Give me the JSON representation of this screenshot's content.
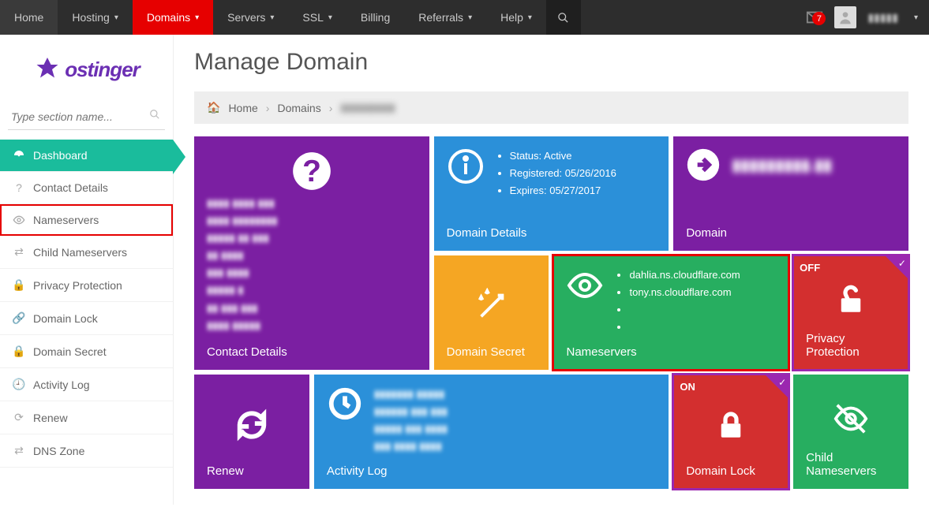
{
  "topnav": {
    "items": [
      {
        "label": "Home",
        "dropdown": false
      },
      {
        "label": "Hosting",
        "dropdown": true
      },
      {
        "label": "Domains",
        "dropdown": true
      },
      {
        "label": "Servers",
        "dropdown": true
      },
      {
        "label": "SSL",
        "dropdown": true
      },
      {
        "label": "Billing",
        "dropdown": false
      },
      {
        "label": "Referrals",
        "dropdown": true
      },
      {
        "label": "Help",
        "dropdown": true
      }
    ],
    "active_index": 2,
    "notification_count": "7",
    "user_name": "▮▮▮▮▮"
  },
  "logo_text": "ostinger",
  "side_search_placeholder": "Type section name...",
  "sidebar": {
    "items": [
      {
        "label": "Dashboard"
      },
      {
        "label": "Contact Details"
      },
      {
        "label": "Nameservers"
      },
      {
        "label": "Child Nameservers"
      },
      {
        "label": "Privacy Protection"
      },
      {
        "label": "Domain Lock"
      },
      {
        "label": "Domain Secret"
      },
      {
        "label": "Activity Log"
      },
      {
        "label": "Renew"
      },
      {
        "label": "DNS Zone"
      }
    ]
  },
  "page_title": "Manage Domain",
  "breadcrumb": {
    "home": "Home",
    "domains": "Domains",
    "current": "▮▮▮▮▮▮▮▮▮"
  },
  "tiles": {
    "contact": {
      "label": "Contact Details",
      "lines": [
        "▮▮▮▮ ▮▮▮▮ ▮▮▮",
        "▮▮▮▮ ▮▮▮▮▮▮▮▮",
        "▮▮▮▮▮ ▮▮ ▮▮▮",
        "▮▮ ▮▮▮▮",
        "▮▮▮ ▮▮▮▮",
        "▮▮▮▮▮ ▮",
        "▮▮ ▮▮▮ ▮▮▮",
        "▮▮▮▮ ▮▮▮▮▮"
      ]
    },
    "details": {
      "label": "Domain Details",
      "status": "Status: Active",
      "registered": "Registered: 05/26/2016",
      "expires": "Expires: 05/27/2017"
    },
    "domain": {
      "label": "Domain",
      "value": "▮▮▮▮▮▮▮▮▮.▮▮"
    },
    "secret": {
      "label": "Domain Secret"
    },
    "ns": {
      "label": "Nameservers",
      "servers": [
        "dahlia.ns.cloudflare.com",
        "tony.ns.cloudflare.com",
        "",
        ""
      ]
    },
    "privacy": {
      "label": "Privacy Protection",
      "tag": "OFF"
    },
    "renew": {
      "label": "Renew"
    },
    "log": {
      "label": "Activity Log",
      "lines": [
        "▮▮▮▮▮▮▮ ▮▮▮▮▮",
        "▮▮▮▮▮▮ ▮▮▮ ▮▮▮",
        "▮▮▮▮▮ ▮▮▮ ▮▮▮▮",
        "▮▮▮ ▮▮▮▮ ▮▮▮▮"
      ]
    },
    "lock": {
      "label": "Domain Lock",
      "tag": "ON"
    },
    "child": {
      "label": "Child Nameservers"
    }
  }
}
